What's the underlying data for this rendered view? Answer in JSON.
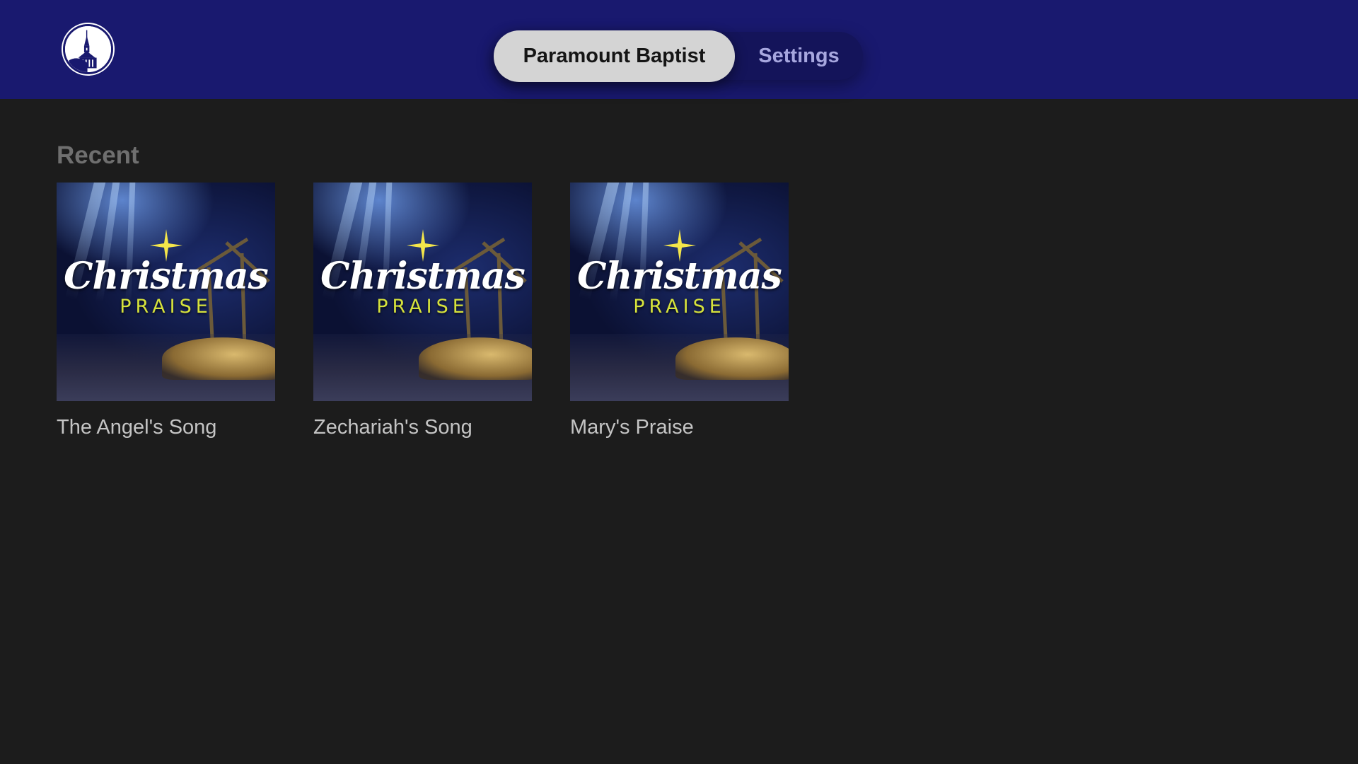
{
  "header": {
    "logo_icon": "church-steeple-icon",
    "tabs": [
      {
        "label": "Paramount Baptist",
        "selected": true
      },
      {
        "label": "Settings",
        "selected": false
      }
    ]
  },
  "recent": {
    "title": "Recent",
    "items": [
      {
        "label": "The Angel's Song",
        "art_title": "Christmas",
        "art_subtitle": "PRAISE"
      },
      {
        "label": "Zechariah's Song",
        "art_title": "Christmas",
        "art_subtitle": "PRAISE"
      },
      {
        "label": "Mary's Praise",
        "art_title": "Christmas",
        "art_subtitle": "PRAISE"
      }
    ]
  },
  "colors": {
    "header_bg": "#19196f",
    "page_bg": "#1c1c1c",
    "tab_active_bg": "#d4d4d4",
    "tab_inactive_text": "#a7a7df",
    "accent_yellow": "#d6e23c"
  }
}
